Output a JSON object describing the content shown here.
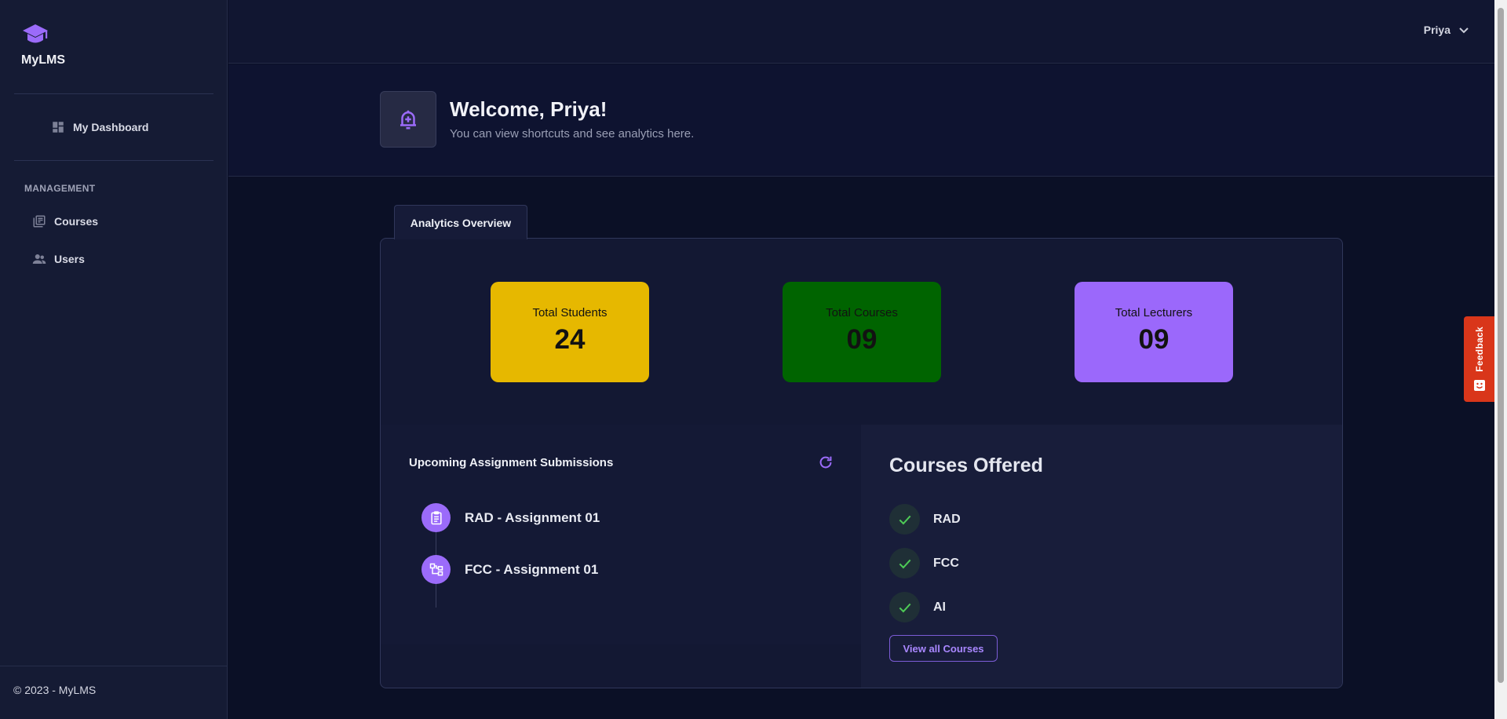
{
  "app": {
    "name": "MyLMS"
  },
  "sidebar": {
    "dashboard_label": "My Dashboard",
    "section_label": "MANAGEMENT",
    "items": [
      {
        "label": "Courses",
        "icon": "courses-icon"
      },
      {
        "label": "Users",
        "icon": "users-icon"
      }
    ],
    "footer": "© 2023 - MyLMS"
  },
  "header": {
    "user_name": "Priya"
  },
  "welcome": {
    "title": "Welcome, Priya!",
    "subtitle": "You can view shortcuts and see analytics here."
  },
  "tab": {
    "label": "Analytics Overview"
  },
  "stats": [
    {
      "label": "Total Students",
      "value": "24",
      "color": "#e6b800"
    },
    {
      "label": "Total Courses",
      "value": "09",
      "color": "#006400"
    },
    {
      "label": "Total Lecturers",
      "value": "09",
      "color": "#9b68fb"
    }
  ],
  "assignments": {
    "title": "Upcoming Assignment Submissions",
    "items": [
      {
        "label": "RAD - Assignment 01",
        "icon": "clipboard-icon"
      },
      {
        "label": "FCC - Assignment 01",
        "icon": "hierarchy-icon"
      }
    ]
  },
  "courses_offered": {
    "title": "Courses Offered",
    "items": [
      "RAD",
      "FCC",
      "AI"
    ],
    "button_label": "View all Courses"
  },
  "feedback": {
    "label": "Feedback"
  },
  "colors": {
    "accent": "#9b6bfa",
    "check": "#4ecb56",
    "feedback": "#d9361a"
  }
}
